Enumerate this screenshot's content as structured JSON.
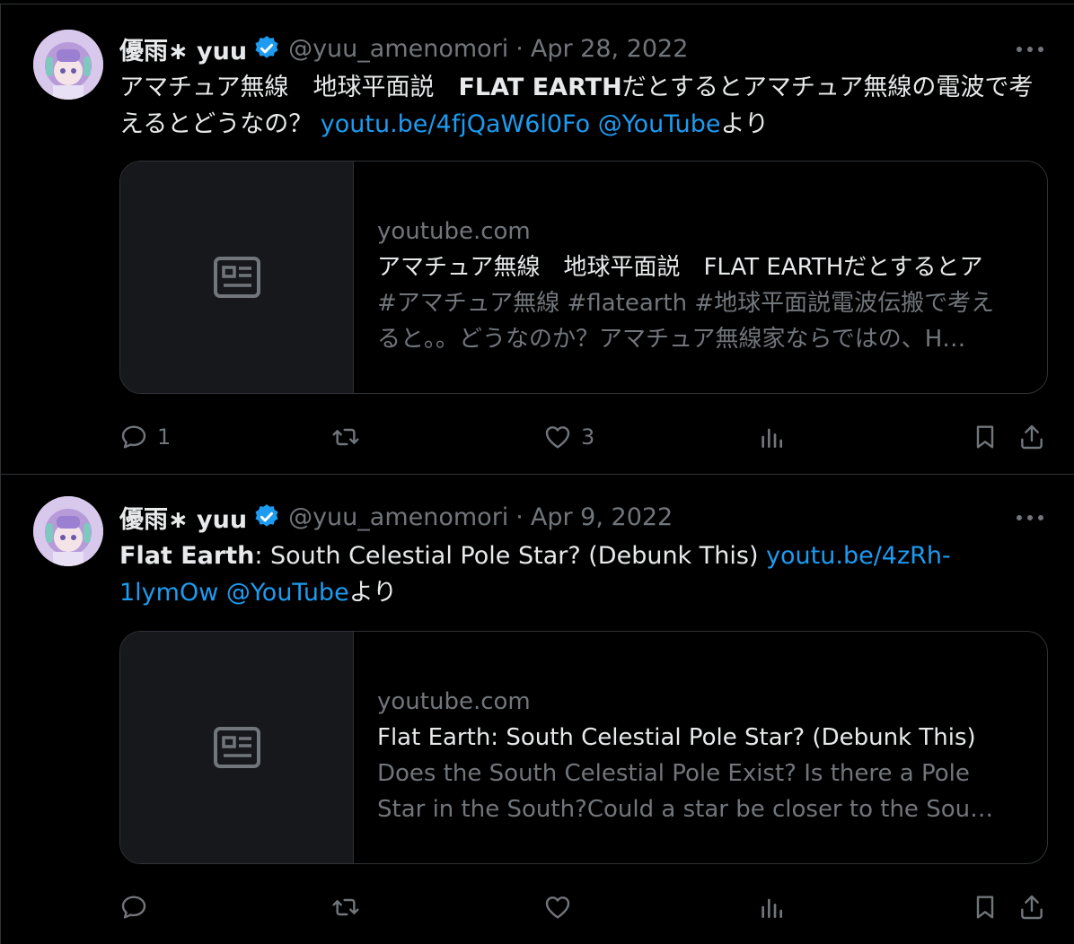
{
  "tweets": [
    {
      "author_name": "優雨∗ yuu",
      "handle": "@yuu_amenomori",
      "separator": "·",
      "date": "Apr 28, 2022",
      "text_parts": {
        "p1": "アマチュア無線　地球平面説　",
        "p2": "FLAT EARTH",
        "p3": "だとするとアマチュア無線の電波で考えるとどうなの？ ",
        "link": "youtu.be/4fjQaW6l0Fo",
        "space": " ",
        "mention": "@YouTube",
        "suffix": "より"
      },
      "card": {
        "domain": "youtube.com",
        "title": "アマチュア無線　地球平面説　FLAT EARTHだとするとア",
        "description_line1": "#アマチュア無線 #flatearth #地球平面説電波伝搬で考え",
        "description_line2": "ると。。どうなのか？アマチュア無線家ならではの、H…"
      },
      "actions": {
        "reply_count": "1",
        "retweet_count": "",
        "like_count": "3"
      },
      "icons": {
        "reply": "reply-icon",
        "retweet": "retweet-icon",
        "like": "heart-icon",
        "views": "analytics-icon",
        "bookmark": "bookmark-icon",
        "share": "share-icon",
        "more": "more-icon",
        "verified": "verified-badge-icon",
        "card_placeholder": "article-icon"
      }
    },
    {
      "author_name": "優雨∗ yuu",
      "handle": "@yuu_amenomori",
      "separator": "·",
      "date": "Apr 9, 2022",
      "text_parts": {
        "p1": "Flat Earth",
        "p2": ": South Celestial Pole Star? (Debunk This) ",
        "link1": "youtu.be/4zRh-",
        "link2": "1lymOw",
        "space": " ",
        "mention": "@YouTube",
        "suffix": "より"
      },
      "card": {
        "domain": "youtube.com",
        "title": "Flat Earth: South Celestial Pole Star? (Debunk This)",
        "description_line1": "Does the South Celestial Pole Exist? Is there a Pole",
        "description_line2": "Star in the South?Could a star be closer to the Sou…"
      },
      "actions": {
        "reply_count": "",
        "retweet_count": "",
        "like_count": ""
      }
    }
  ],
  "colors": {
    "background": "#000000",
    "text": "#e7e9ea",
    "muted": "#71767b",
    "link": "#1d9bf0",
    "border": "#2f3336",
    "verified": "#1d9bf0"
  }
}
